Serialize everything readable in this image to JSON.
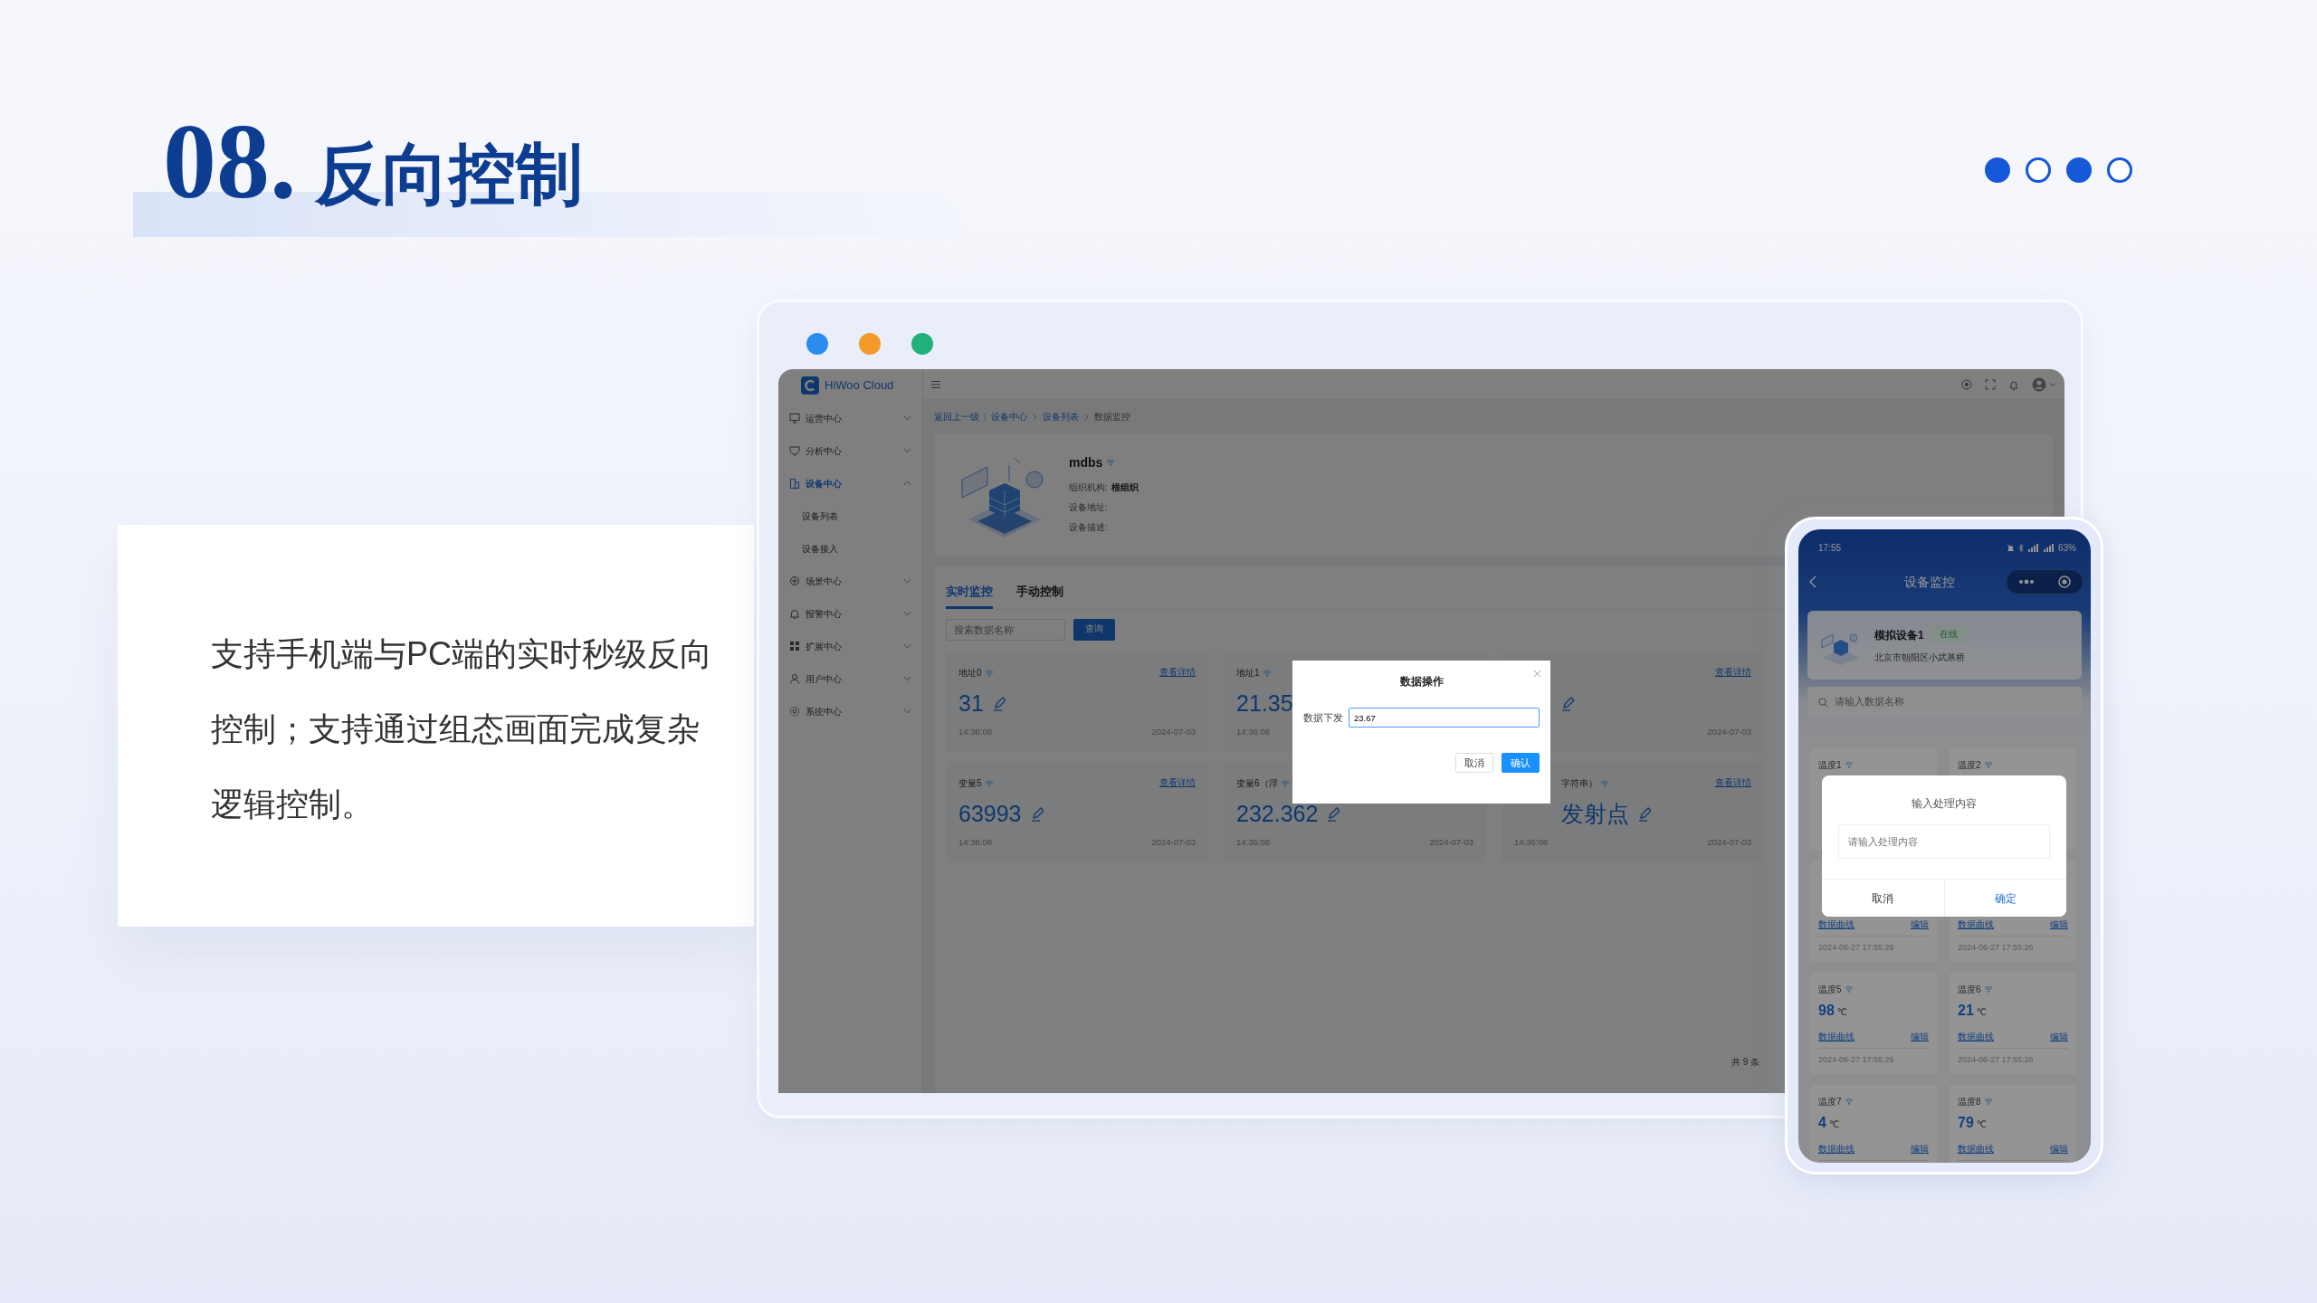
{
  "slide": {
    "number": "08.",
    "title": "反向控制",
    "page_dots": [
      {
        "selected": true
      },
      {
        "selected": false
      },
      {
        "selected": true
      },
      {
        "selected": false
      }
    ],
    "description": "支持手机端与PC端的实时秒级反向控制；支持通过组态画面完成复杂逻辑控制。"
  },
  "pc_window": {
    "traffic_lights": [
      {
        "color": "#2b8cf0"
      },
      {
        "color": "#f39a2b"
      },
      {
        "color": "#22b07d"
      }
    ],
    "app": {
      "logo": "HiWoo Cloud",
      "sidebar": [
        {
          "label": "运营中心",
          "selected": false,
          "expanded": false
        },
        {
          "label": "分析中心",
          "selected": false,
          "expanded": false
        },
        {
          "label": "设备中心",
          "selected": true,
          "expanded": true,
          "children": [
            {
              "label": "设备列表",
              "selected": false
            },
            {
              "label": "设备接入",
              "selected": false
            }
          ]
        },
        {
          "label": "场景中心",
          "selected": false,
          "expanded": false
        },
        {
          "label": "报警中心",
          "selected": false,
          "expanded": false
        },
        {
          "label": "扩展中心",
          "selected": false,
          "expanded": false
        },
        {
          "label": "用户中心",
          "selected": false,
          "expanded": false
        },
        {
          "label": "系统中心",
          "selected": false,
          "expanded": false
        }
      ],
      "breadcrumb": [
        {
          "label": "返回上一级",
          "kind": "back"
        },
        {
          "label": "设备中心",
          "kind": "link"
        },
        {
          "label": "设备列表",
          "kind": "link"
        },
        {
          "label": "数据监控",
          "kind": "current"
        }
      ],
      "device": {
        "name": "mdbs",
        "fields": [
          {
            "label": "组织机构:",
            "value": "根组织"
          },
          {
            "label": "设备地址:"
          },
          {
            "label": "设备描述:"
          }
        ]
      },
      "tabs": [
        {
          "label": "实时监控",
          "selected": true
        },
        {
          "label": "手动控制",
          "selected": false
        }
      ],
      "search": {
        "placeholder": "搜索数据名称",
        "button": "查询"
      },
      "cards": [
        {
          "title": "地址0",
          "link": "查看详情",
          "value": "31",
          "editable": true,
          "time": "14:36:08",
          "date": "2024-07-03"
        },
        {
          "title": "地址1",
          "value": "21.35",
          "time": "14:36:08"
        },
        {
          "link": "查看详情",
          "editable": true,
          "date": "2024-07-03",
          "partly_hidden": true
        },
        {
          "title": "变量5",
          "link": "查看详情",
          "value": "63993",
          "editable": true,
          "time": "14:36:08",
          "date": "2024-07-03"
        },
        {
          "title": "变量6（浮",
          "value": "232.362",
          "editable": true,
          "time": "14:36:08",
          "date": "2024-07-03"
        },
        {
          "title": "字符串）",
          "link": "查看详情",
          "value": "发射点",
          "editable": true,
          "time": "14:36:08",
          "date": "2024-07-03",
          "partly_hidden": true
        }
      ],
      "total": "共 9 条",
      "modal": {
        "title": "数据操作",
        "label": "数据下发",
        "value": "23.67",
        "buttons": [
          {
            "label": "取消",
            "kind": "secondary"
          },
          {
            "label": "确认",
            "kind": "primary"
          }
        ]
      }
    }
  },
  "phone": {
    "time": "17:55",
    "battery": "63%",
    "title": "设备监控",
    "device": {
      "name": "模拟设备1",
      "status": "在线",
      "address": "北京市朝阳区小武基桥"
    },
    "search_placeholder": "请输入数据名称",
    "cards": [
      {
        "title": "温度1"
      },
      {
        "title": "温度2"
      },
      {
        "chart_link": "数据曲线",
        "edit_link": "编辑",
        "date": "2024-06-27 17:55:26"
      },
      {
        "chart_link": "数据曲线",
        "edit_link": "编辑",
        "date": "2024-06-27 17:55:26"
      },
      {
        "title": "温度5",
        "value": "98",
        "unit": "℃",
        "chart_link": "数据曲线",
        "edit_link": "编辑",
        "date": "2024-06-27 17:55:26"
      },
      {
        "title": "温度6",
        "value": "21",
        "unit": "℃",
        "chart_link": "数据曲线",
        "edit_link": "编辑",
        "date": "2024-06-27 17:55:26"
      },
      {
        "title": "温度7",
        "value": "4",
        "unit": "℃",
        "chart_link": "数据曲线",
        "edit_link": "编辑"
      },
      {
        "title": "温度8",
        "value": "79",
        "unit": "℃",
        "chart_link": "数据曲线",
        "edit_link": "编辑"
      }
    ],
    "dialog": {
      "title": "输入处理内容",
      "placeholder": "请输入处理内容",
      "buttons": [
        {
          "label": "取消",
          "kind": "secondary"
        },
        {
          "label": "确定",
          "kind": "primary"
        }
      ]
    }
  }
}
